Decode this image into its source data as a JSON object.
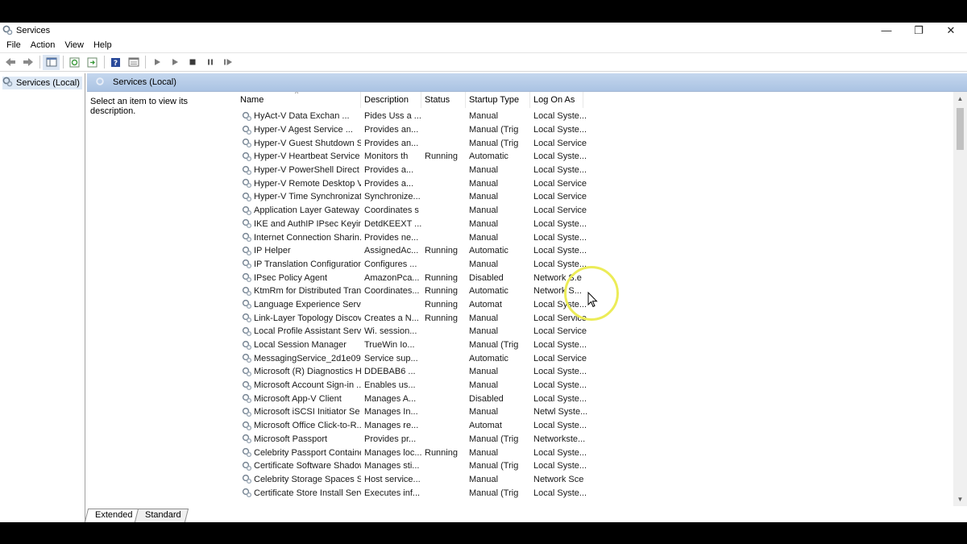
{
  "window": {
    "title": "Services",
    "controls": {
      "minimize": "—",
      "restore": "❐",
      "close": "✕"
    }
  },
  "menu": [
    "File",
    "Action",
    "View",
    "Help"
  ],
  "tree": {
    "root_label": "Services (Local)"
  },
  "main": {
    "header_label": "Services (Local)",
    "description_prompt": "Select an item to view its description."
  },
  "columns": {
    "name": "Name",
    "description": "Description",
    "status": "Status",
    "startup_type": "Startup Type",
    "log_on_as": "Log On As"
  },
  "services": [
    {
      "name": "HyAct-V Data Exchan ...",
      "description": "Pides Uss a ...",
      "status": "",
      "startup": "Manual",
      "logon": "Local Syste..."
    },
    {
      "name": "Hyper-V Agest Service ...",
      "description": "Provides an...",
      "status": "",
      "startup": "Manual (Trig",
      "logon": "Local Syste..."
    },
    {
      "name": "Hyper-V Guest Shutdown S...",
      "description": "Provides an...",
      "status": "",
      "startup": "Manual (Trig",
      "logon": "Local Service"
    },
    {
      "name": "Hyper-V Heartbeat Service",
      "description": "Monitors th",
      "status": "Running",
      "startup": "Automatic",
      "logon": "Local Syste..."
    },
    {
      "name": "Hyper-V PowerShell Direct ...",
      "description": "Provides a...",
      "status": "",
      "startup": "Manual",
      "logon": "Local Syste..."
    },
    {
      "name": "Hyper-V Remote Desktop Vi...",
      "description": "Provides a...",
      "status": "",
      "startup": "Manual",
      "logon": "Local Service"
    },
    {
      "name": "Hyper-V Time Synchronizati...",
      "description": "Synchronize...",
      "status": "",
      "startup": "Manual",
      "logon": "Local Service"
    },
    {
      "name": "Application Layer Gateway C...",
      "description": "Coordinates s",
      "status": "",
      "startup": "Manual",
      "logon": "Local Service"
    },
    {
      "name": "IKE and AuthIP IPsec Keying...",
      "description": "DetdKEEXT ...",
      "status": "",
      "startup": "Manual",
      "logon": "Local Syste..."
    },
    {
      "name": "Internet Connection Sharin...",
      "description": "Provides ne...",
      "status": "",
      "startup": "Manual",
      "logon": "Local Syste..."
    },
    {
      "name": "IP Helper",
      "description": "AssignedAc...",
      "status": "Running",
      "startup": "Automatic",
      "logon": "Local Syste..."
    },
    {
      "name": "IP Translation Configuration ...",
      "description": "Configures ...",
      "status": "",
      "startup": "Manual",
      "logon": "Local Syste..."
    },
    {
      "name": "IPsec Policy Agent",
      "description": "AmazonPca...",
      "status": "Running",
      "startup": "Disabled",
      "logon": "Network S.e"
    },
    {
      "name": "KtmRm for Distributed Tran",
      "description": "Coordinates...",
      "status": "Running",
      "startup": "Automatic",
      "logon": "Network S..."
    },
    {
      "name": "Language Experience Service",
      "description": "",
      "status": "Running",
      "startup": "Automat",
      "logon": "Local Syste..."
    },
    {
      "name": "Link-Layer Topology Discov...",
      "description": "Creates a N...",
      "status": "Running",
      "startup": "Manual",
      "logon": "Local Service"
    },
    {
      "name": "Local Profile Assistant Service",
      "description": "Wi. session...",
      "status": "",
      "startup": "Manual",
      "logon": "Local Service"
    },
    {
      "name": "Local Session Manager",
      "description": "TrueWin Io...",
      "status": "",
      "startup": "Manual (Trig",
      "logon": "Local Syste..."
    },
    {
      "name": "MessagingService_2d1e09a",
      "description": "Service sup...",
      "status": "",
      "startup": "Automatic",
      "logon": "Local Service"
    },
    {
      "name": "Microsoft (R) Diagnostics H...",
      "description": "DDEBAB6 ...",
      "status": "",
      "startup": "Manual",
      "logon": "Local Syste..."
    },
    {
      "name": "Microsoft Account Sign-in ...",
      "description": "Enables us...",
      "status": "",
      "startup": "Manual",
      "logon": "Local Syste..."
    },
    {
      "name": "Microsoft App-V Client",
      "description": "Manages A...",
      "status": "",
      "startup": "Disabled",
      "logon": "Local Syste..."
    },
    {
      "name": "Microsoft iSCSI Initiator Se",
      "description": "Manages In...",
      "status": "",
      "startup": "Manual",
      "logon": "Netwl Syste..."
    },
    {
      "name": "Microsoft Office Click-to-R...",
      "description": "Manages re...",
      "status": "",
      "startup": "Automat",
      "logon": "Local Syste..."
    },
    {
      "name": "Microsoft Passport",
      "description": "Provides pr...",
      "status": "",
      "startup": "Manual (Trig",
      "logon": "Networkste..."
    },
    {
      "name": "Celebrity Passport Container",
      "description": "Manages loc...",
      "status": "Running",
      "startup": "Manual",
      "logon": "Local Syste..."
    },
    {
      "name": "Certificate Software Shadow",
      "description": "Manages sti...",
      "status": "",
      "startup": "Manual (Trig",
      "logon": "Local Syste..."
    },
    {
      "name": "Celebrity Storage Spaces S...",
      "description": "Host service...",
      "status": "",
      "startup": "Manual",
      "logon": "Network Sce"
    },
    {
      "name": "Certificate Store Install Service",
      "description": "Executes inf...",
      "status": "",
      "startup": "Manual (Trig",
      "logon": "Local Syste..."
    }
  ],
  "tabs": [
    "Extended",
    "Standard"
  ]
}
